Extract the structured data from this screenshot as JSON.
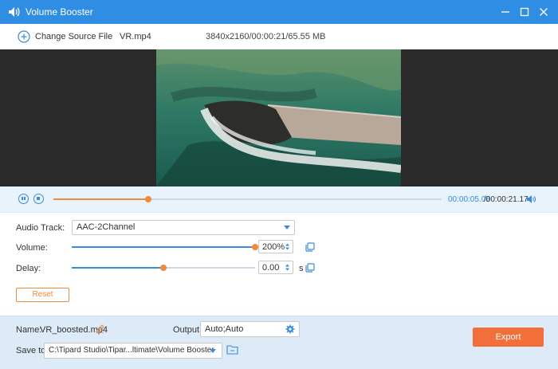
{
  "window": {
    "title": "Volume Booster",
    "icons": {
      "app": "speaker-icon",
      "minimize": "minimize-icon",
      "maximize": "maximize-icon",
      "close": "close-icon"
    }
  },
  "source": {
    "change_label": "Change Source File",
    "filename": "VR.mp4",
    "info": "3840x2160/00:00:21/65.55 MB"
  },
  "playback": {
    "current_time": "00:00:05.08",
    "total_time": "/00:00:21.17",
    "progress": 0.245
  },
  "settings": {
    "audio_track_label": "Audio Track:",
    "audio_track_value": "AAC-2Channel",
    "volume_label": "Volume:",
    "volume_value": "200%",
    "volume_level": 1.0,
    "delay_label": "Delay:",
    "delay_value": "0.00",
    "delay_unit": "s",
    "delay_level": 0.5,
    "reset_label": "Reset"
  },
  "output": {
    "name_label": "Name:",
    "name_value": "VR_boosted.mp4",
    "output_label": "Output:",
    "output_value": "Auto;Auto",
    "saveto_label": "Save to:",
    "saveto_value": "C:\\Tipard Studio\\Tipar...ltimate\\Volume Booster",
    "export_label": "Export"
  },
  "colors": {
    "titlebar": "#2f8de4",
    "accent": "#3a8bd8",
    "orange": "#f08a3c",
    "export": "#f26f3a"
  }
}
